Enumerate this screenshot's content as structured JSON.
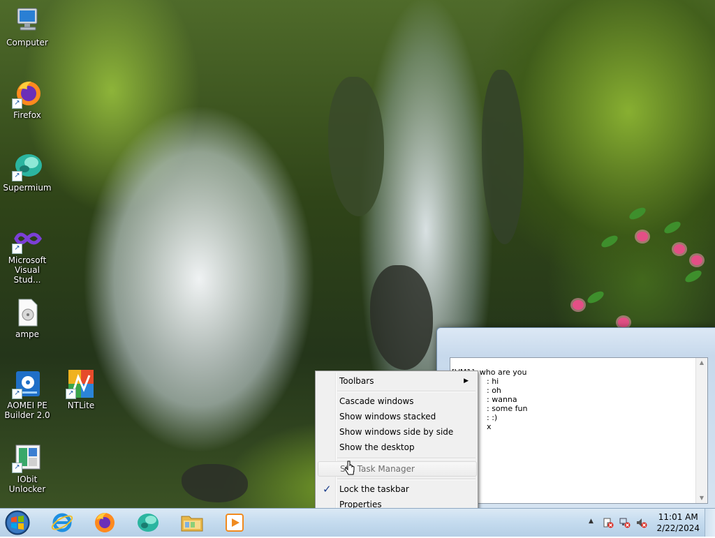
{
  "desktop": {
    "icons": [
      {
        "label": "Computer",
        "icon": "computer-icon"
      },
      {
        "label": "Firefox",
        "icon": "firefox-icon"
      },
      {
        "label": "Supermium",
        "icon": "supermium-icon"
      },
      {
        "label": "Microsoft Visual Stud...",
        "icon": "visual-studio-icon"
      },
      {
        "label": "ampe",
        "icon": "audio-file-icon"
      },
      {
        "label": "AOMEI PE Builder 2.0",
        "icon": "aomei-pe-builder-icon"
      },
      {
        "label": "NTLite",
        "icon": "ntlite-icon"
      },
      {
        "label": "IObit Unlocker",
        "icon": "iobit-unlocker-icon"
      }
    ]
  },
  "background_window": {
    "lines": [
      "[VM1]: who are you",
      ": hi",
      ": oh",
      ": wanna",
      ": some fun",
      ": :)",
      "x"
    ]
  },
  "context_menu": {
    "items": [
      {
        "label": "Toolbars",
        "has_submenu": true
      },
      {
        "label": "Cascade windows"
      },
      {
        "label": "Show windows stacked"
      },
      {
        "label": "Show windows side by side"
      },
      {
        "label": "Show the desktop"
      },
      {
        "label": "Start Task Manager",
        "visible_label": "St  t Task Manager",
        "disabled": true
      },
      {
        "label": "Lock the taskbar",
        "checked": true,
        "check_glyph": "✓"
      },
      {
        "label": "Properties"
      }
    ],
    "submenu_glyph": "▶"
  },
  "taskbar": {
    "start_icon": "windows-start-orb-icon",
    "pinned": [
      {
        "name": "internet-explorer",
        "icon": "internet-explorer-icon"
      },
      {
        "name": "firefox",
        "icon": "firefox-icon"
      },
      {
        "name": "supermium",
        "icon": "supermium-icon"
      },
      {
        "name": "file-explorer",
        "icon": "folder-icon"
      },
      {
        "name": "media-player",
        "icon": "media-player-icon"
      }
    ],
    "tray": {
      "show_hidden_glyph": "▲",
      "icons": [
        "action-center-error-icon",
        "network-error-icon",
        "volume-muted-icon"
      ],
      "time": "11:01 AM",
      "date": "2/22/2024"
    }
  },
  "colors": {
    "taskbar_top": "#dbe9f5",
    "menu_bg": "#f0f0f0",
    "accent_blue": "#1f5ea8"
  }
}
